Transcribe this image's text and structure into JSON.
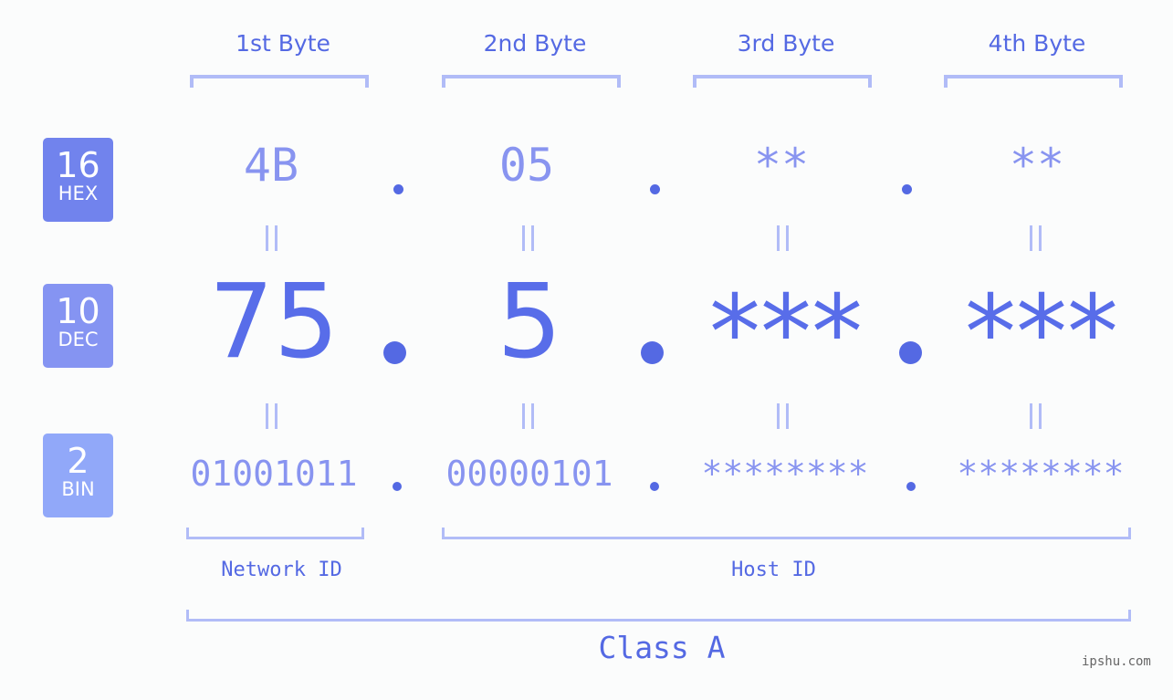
{
  "bases": [
    {
      "number": "16",
      "label": "HEX",
      "color": "#7183ed"
    },
    {
      "number": "10",
      "label": "DEC",
      "color": "#8594f2"
    },
    {
      "number": "2",
      "label": "BIN",
      "color": "#91a8f9"
    }
  ],
  "byte_headers": [
    "1st Byte",
    "2nd Byte",
    "3rd Byte",
    "4th Byte"
  ],
  "hex": [
    "4B",
    "05",
    "**",
    "**"
  ],
  "dec": [
    "75",
    "5",
    "***",
    "***"
  ],
  "bin": [
    "01001011",
    "00000101",
    "********",
    "********"
  ],
  "separator": ".",
  "equals_symbol": "=",
  "network_id_label": "Network ID",
  "host_id_label": "Host ID",
  "class_label": "Class A",
  "watermark": "ipshu.com",
  "colors": {
    "accent": "#5469e3",
    "light_value": "#8894f0",
    "bracket": "#b1bcf7",
    "background": "#fbfcfc"
  }
}
